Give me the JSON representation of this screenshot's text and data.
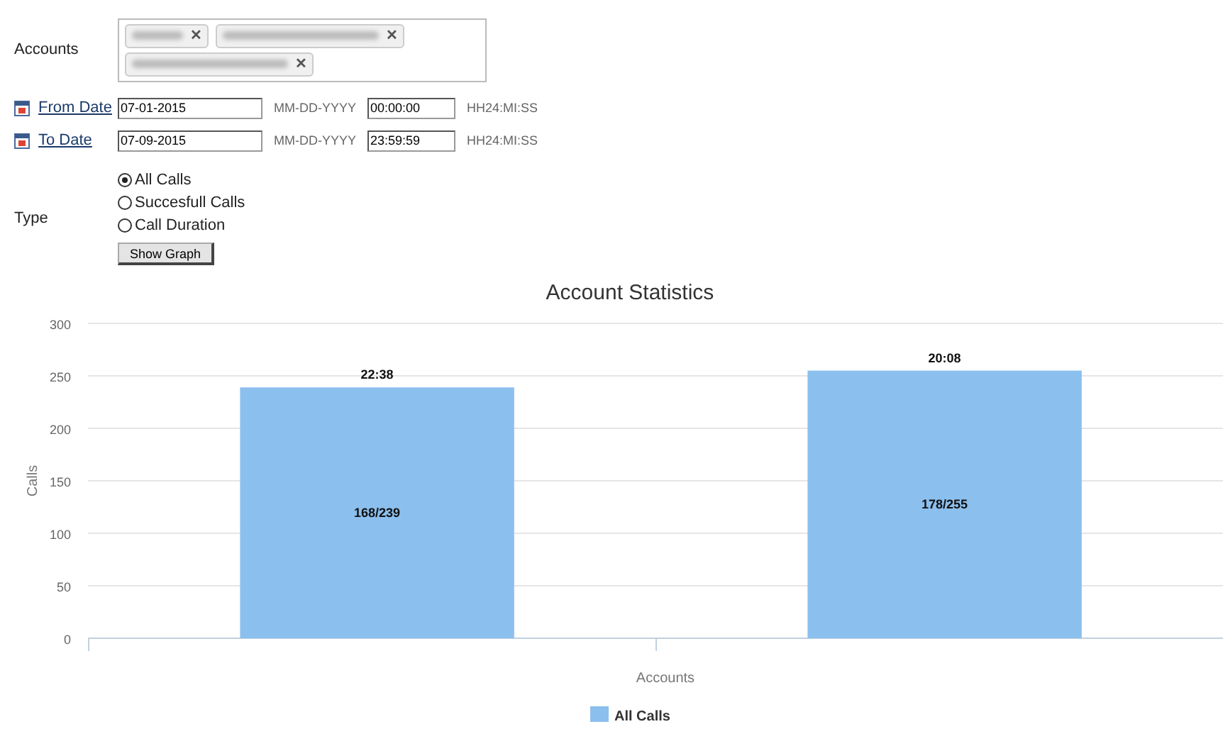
{
  "form": {
    "accounts": {
      "label": "Accounts",
      "tags": [
        {
          "remove": "✕"
        },
        {
          "remove": "✕"
        },
        {
          "remove": "✕"
        }
      ]
    },
    "dates": [
      {
        "link": "From Date",
        "date": "07-01-2015",
        "date_hint": "MM-DD-YYYY",
        "time": "00:00:00",
        "time_hint": "HH24:MI:SS"
      },
      {
        "link": "To Date",
        "date": "07-09-2015",
        "date_hint": "MM-DD-YYYY",
        "time": "23:59:59",
        "time_hint": "HH24:MI:SS"
      }
    ],
    "type": {
      "label": "Type",
      "options": [
        {
          "label": "All Calls",
          "selected": true
        },
        {
          "label": "Succesfull Calls",
          "selected": false
        },
        {
          "label": "Call Duration",
          "selected": false
        }
      ]
    },
    "button": "Show Graph"
  },
  "chart": {
    "chart_data": {
      "type": "bar",
      "title": "Account Statistics",
      "xlabel": "Accounts",
      "ylabel": "Calls",
      "ylim": [
        0,
        300
      ],
      "grid": true,
      "yticks": [
        0,
        50,
        100,
        150,
        200,
        250,
        300
      ],
      "series": [
        {
          "name": "All Calls",
          "color": "#8bbfee",
          "values": [
            239,
            255
          ]
        }
      ],
      "annotations": [
        "22:38",
        "168/239",
        "20:08",
        "178/255"
      ]
    }
  }
}
